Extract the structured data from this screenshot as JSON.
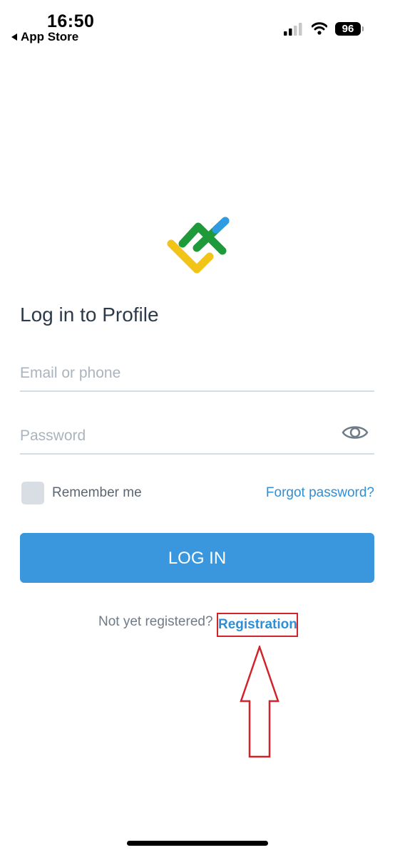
{
  "status_bar": {
    "time": "16:50",
    "back_label": "App Store",
    "battery": "96"
  },
  "login": {
    "title": "Log in to Profile",
    "email_placeholder": "Email or phone",
    "password_placeholder": "Password",
    "remember_label": "Remember me",
    "remember_checked": false,
    "forgot_label": "Forgot password?",
    "login_button": "LOG IN",
    "not_registered": "Not yet registered?",
    "registration_link": "Registration"
  },
  "colors": {
    "accent": "#3a96dd",
    "link": "#2f8fd6",
    "annotation": "#d2232a",
    "logo_green": "#1f9a3a",
    "logo_yellow": "#f2c418",
    "logo_blue": "#2f9be0"
  },
  "icons": {
    "password_toggle": "eye-icon",
    "back": "caret-left-icon",
    "signal": "cellular-signal-icon",
    "wifi": "wifi-icon",
    "battery": "battery-icon"
  }
}
